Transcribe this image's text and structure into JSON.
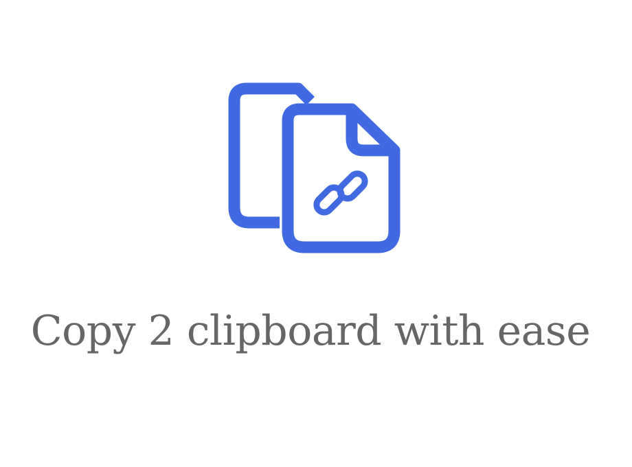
{
  "logo": {
    "icon": "copy-link-files-icon",
    "color": "#4169E1"
  },
  "tagline": "Copy 2 clipboard with ease",
  "colors": {
    "background": "#FFFFFF",
    "text": "#666666"
  }
}
